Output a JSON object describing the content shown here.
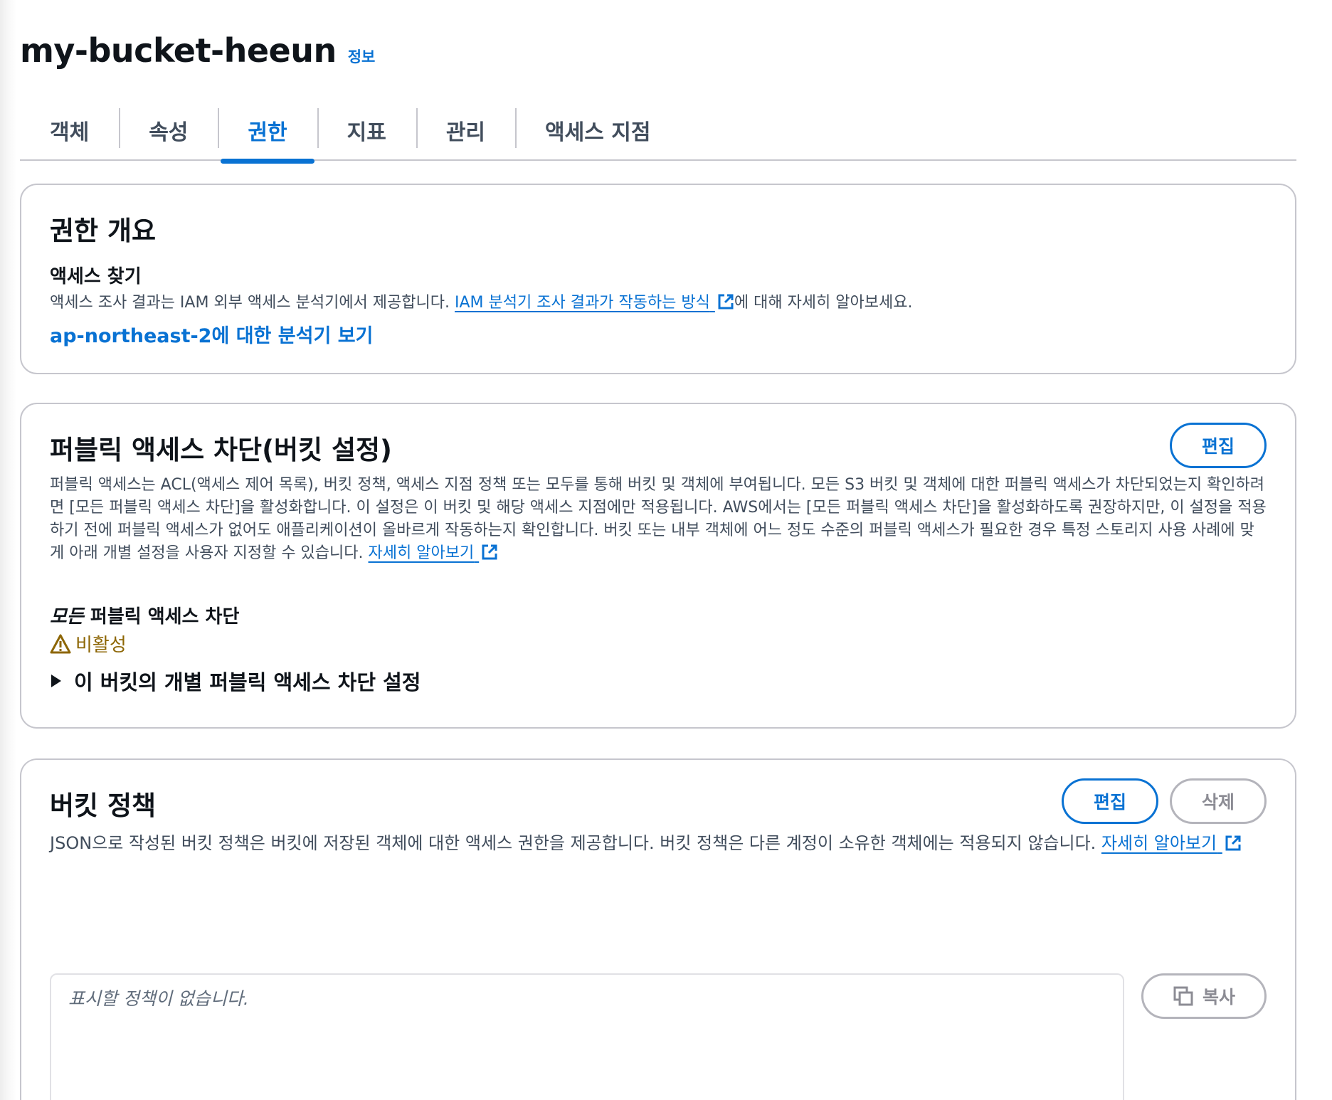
{
  "header": {
    "bucket_name": "my-bucket-heeun",
    "info_label": "정보"
  },
  "tabs": [
    {
      "label": "객체",
      "active": false
    },
    {
      "label": "속성",
      "active": false
    },
    {
      "label": "권한",
      "active": true
    },
    {
      "label": "지표",
      "active": false
    },
    {
      "label": "관리",
      "active": false
    },
    {
      "label": "액세스 지점",
      "active": false
    }
  ],
  "overview": {
    "title": "권한 개요",
    "access_findings_title": "액세스 찾기",
    "desc_prefix": "액세스 조사 결과는 IAM 외부 액세스 분석기에서 제공합니다.",
    "desc_link": "IAM 분석기 조사 결과가 작동하는 방식",
    "desc_suffix": "에 대해 자세히 알아보세요.",
    "analyzer_link": "ap-northeast-2에 대한 분석기 보기"
  },
  "block_public": {
    "title": "퍼블릭 액세스 차단(버킷 설정)",
    "edit_label": "편집",
    "description": "퍼블릭 액세스는 ACL(액세스 제어 목록), 버킷 정책, 액세스 지점 정책 또는 모두를 통해 버킷 및 객체에 부여됩니다. 모든 S3 버킷 및 객체에 대한 퍼블릭 액세스가 차단되었는지 확인하려면 [모든 퍼블릭 액세스 차단]을 활성화합니다. 이 설정은 이 버킷 및 해당 액세스 지점에만 적용됩니다. AWS에서는 [모든 퍼블릭 액세스 차단]을 활성화하도록 권장하지만, 이 설정을 적용하기 전에 퍼블릭 액세스가 없어도 애플리케이션이 올바르게 작동하는지 확인합니다. 버킷 또는 내부 객체에 어느 정도 수준의 퍼블릭 액세스가 필요한 경우 특정 스토리지 사용 사례에 맞게 아래 개별 설정을 사용자 지정할 수 있습니다.",
    "learn_more": "자세히 알아보기",
    "block_all_em": "모든",
    "block_all_rest": "퍼블릭 액세스 차단",
    "status": "비활성",
    "status_icon": "warning-icon",
    "expander_label": "이 버킷의 개별 퍼블릭 액세스 차단 설정"
  },
  "bucket_policy": {
    "title": "버킷 정책",
    "edit_label": "편집",
    "delete_label": "삭제",
    "description": "JSON으로 작성된 버킷 정책은 버킷에 저장된 객체에 대한 액세스 권한을 제공합니다. 버킷 정책은 다른 계정이 소유한 객체에는 적용되지 않습니다.",
    "learn_more": "자세히 알아보기",
    "placeholder": "표시할 정책이 없습니다.",
    "copy_label": "복사",
    "copy_icon": "copy-icon"
  },
  "colors": {
    "accent": "#0972d3",
    "warning": "#8d6605",
    "border": "#c6c6cd",
    "disabled": "#8c8c94"
  }
}
